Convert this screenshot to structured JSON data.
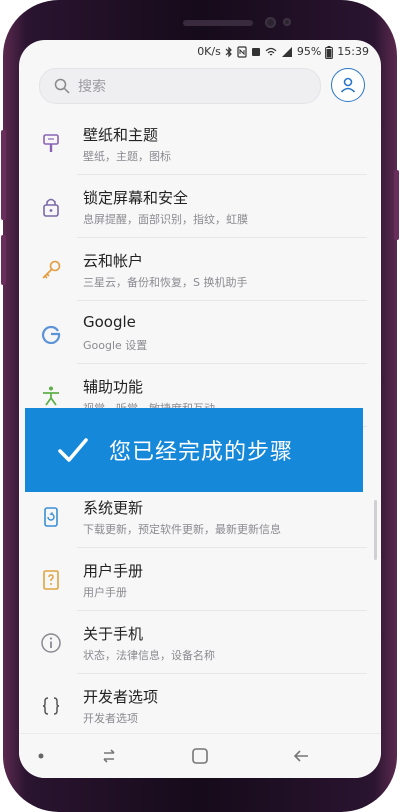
{
  "status": {
    "speed": "0K/s",
    "battery": "95%",
    "time": "15:39"
  },
  "search": {
    "placeholder": "搜索"
  },
  "settings": [
    {
      "title": "壁纸和主题",
      "subtitle": "壁纸，主题，图标",
      "icon": "brush-icon"
    },
    {
      "title": "锁定屏幕和安全",
      "subtitle": "息屏提醒，面部识别，指纹，虹膜",
      "icon": "lock-icon"
    },
    {
      "title": "云和帐户",
      "subtitle": "三星云，备份和恢复，S 换机助手",
      "icon": "key-icon"
    },
    {
      "title": "Google",
      "subtitle": "Google 设置",
      "icon": "google-icon"
    },
    {
      "title": "辅助功能",
      "subtitle": "视觉，听觉，敏捷度和互动",
      "icon": "accessibility-icon"
    },
    {
      "title": "系统更新",
      "subtitle": "下载更新，预定软件更新，最新更新信息",
      "icon": "update-icon"
    },
    {
      "title": "用户手册",
      "subtitle": "用户手册",
      "icon": "manual-icon"
    },
    {
      "title": "关于手机",
      "subtitle": "状态，法律信息，设备名称",
      "icon": "info-icon"
    },
    {
      "title": "开发者选项",
      "subtitle": "开发者选项",
      "icon": "braces-icon"
    }
  ],
  "overlay": {
    "text": "您已经完成的步骤"
  },
  "colors": {
    "accent": "#1688d9",
    "frame": "#5b2a4f"
  }
}
